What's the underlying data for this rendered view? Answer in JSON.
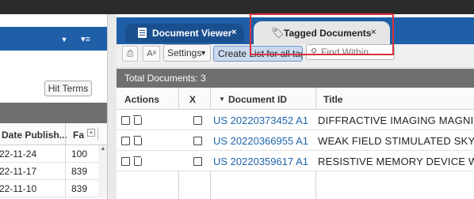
{
  "left_panel": {
    "hit_terms_button": "Hit Terms",
    "columns": {
      "date_published": "Date Publish...",
      "family": "Fa"
    },
    "rows": [
      {
        "date": "22-11-24",
        "value": "100"
      },
      {
        "date": "22-11-17",
        "value": "839"
      },
      {
        "date": "22-11-10",
        "value": "839"
      }
    ]
  },
  "tabs": [
    {
      "label": "Document Viewer",
      "close": "×",
      "active": false
    },
    {
      "label": "Tagged Documents",
      "close": "×",
      "active": true
    }
  ],
  "toolbar": {
    "settings_label": "Settings",
    "settings_caret": "▼",
    "create_button": "Create List for all tags",
    "find_placeholder": "Find Within"
  },
  "summary": {
    "total_documents": "Total Documents: 3"
  },
  "table": {
    "columns": {
      "actions": "Actions",
      "x": "X",
      "document_id": "Document ID",
      "title": "Title"
    },
    "sort_indicator": "▼",
    "rows": [
      {
        "document_id": "US 20220373452 A1",
        "title": "DIFFRACTIVE IMAGING MAGNI"
      },
      {
        "document_id": "US 20220366955 A1",
        "title": "WEAK FIELD STIMULATED SKY"
      },
      {
        "document_id": "US 20220359617 A1",
        "title": "RESISTIVE MEMORY DEVICE W"
      }
    ]
  },
  "colors": {
    "accent_blue": "#1f5fa8",
    "tab_active": "#e6e6e6",
    "highlight_red": "#d8323c",
    "link_blue": "#1e64aa",
    "summary_bar": "#6f6f6f"
  }
}
